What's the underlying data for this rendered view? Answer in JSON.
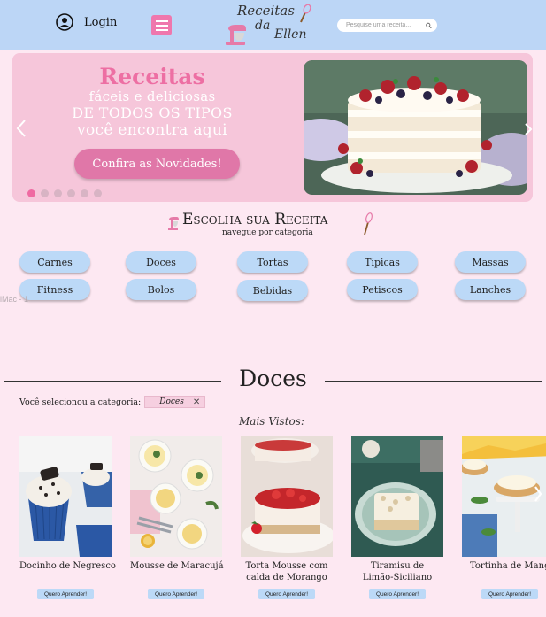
{
  "header": {
    "login_label": "Login",
    "logo_line1": "Receitas",
    "logo_line2": "da",
    "logo_line3": "Ellen",
    "search_placeholder": "Pesquise uma receita..."
  },
  "banner": {
    "title": "Receitas",
    "line1": "fáceis e deliciosas",
    "line2": "DE TODOS OS TIPOS",
    "line3": "você encontra aqui",
    "cta_label": "Confira as Novidades!",
    "dots_count": 6,
    "active_dot": 1
  },
  "choose": {
    "title": "Escolha sua Receita",
    "subtitle": "navegue por categoria"
  },
  "categories": {
    "row1": [
      "Carnes",
      "Doces",
      "Tortas",
      "Típicas",
      "Massas"
    ],
    "row2": [
      "Fitness",
      "Bolos",
      "Bebidas",
      "Petiscos",
      "Lanches"
    ]
  },
  "artboard_label": "iMac - 1",
  "section": {
    "title": "Doces",
    "selected_label": "Você selecionou a categoria:",
    "selected_chip": "Doces",
    "most_viewed": "Mais Vistos:"
  },
  "recipes": [
    {
      "title": "Docinho de Negresco",
      "button": "Quero Aprender!"
    },
    {
      "title": "Mousse de Maracujá",
      "button": "Quero Aprender!"
    },
    {
      "title": "Torta Mousse com\ncalda de Morango",
      "line1": "Torta Mousse com",
      "line2": "calda de Morango",
      "button": "Quero Aprender!"
    },
    {
      "title": "Tiramisu de\nLimão-Siciliano",
      "line1": "Tiramisu de",
      "line2": "Limão-Siciliano",
      "button": "Quero Aprender!"
    },
    {
      "title": "Tortinha de Manga",
      "button": "Quero Aprender!"
    }
  ],
  "colors": {
    "header_bg": "#bcd6f6",
    "page_bg": "#fde8f2",
    "accent_pink": "#ef77ad",
    "category_blue": "#bcd9f7"
  }
}
